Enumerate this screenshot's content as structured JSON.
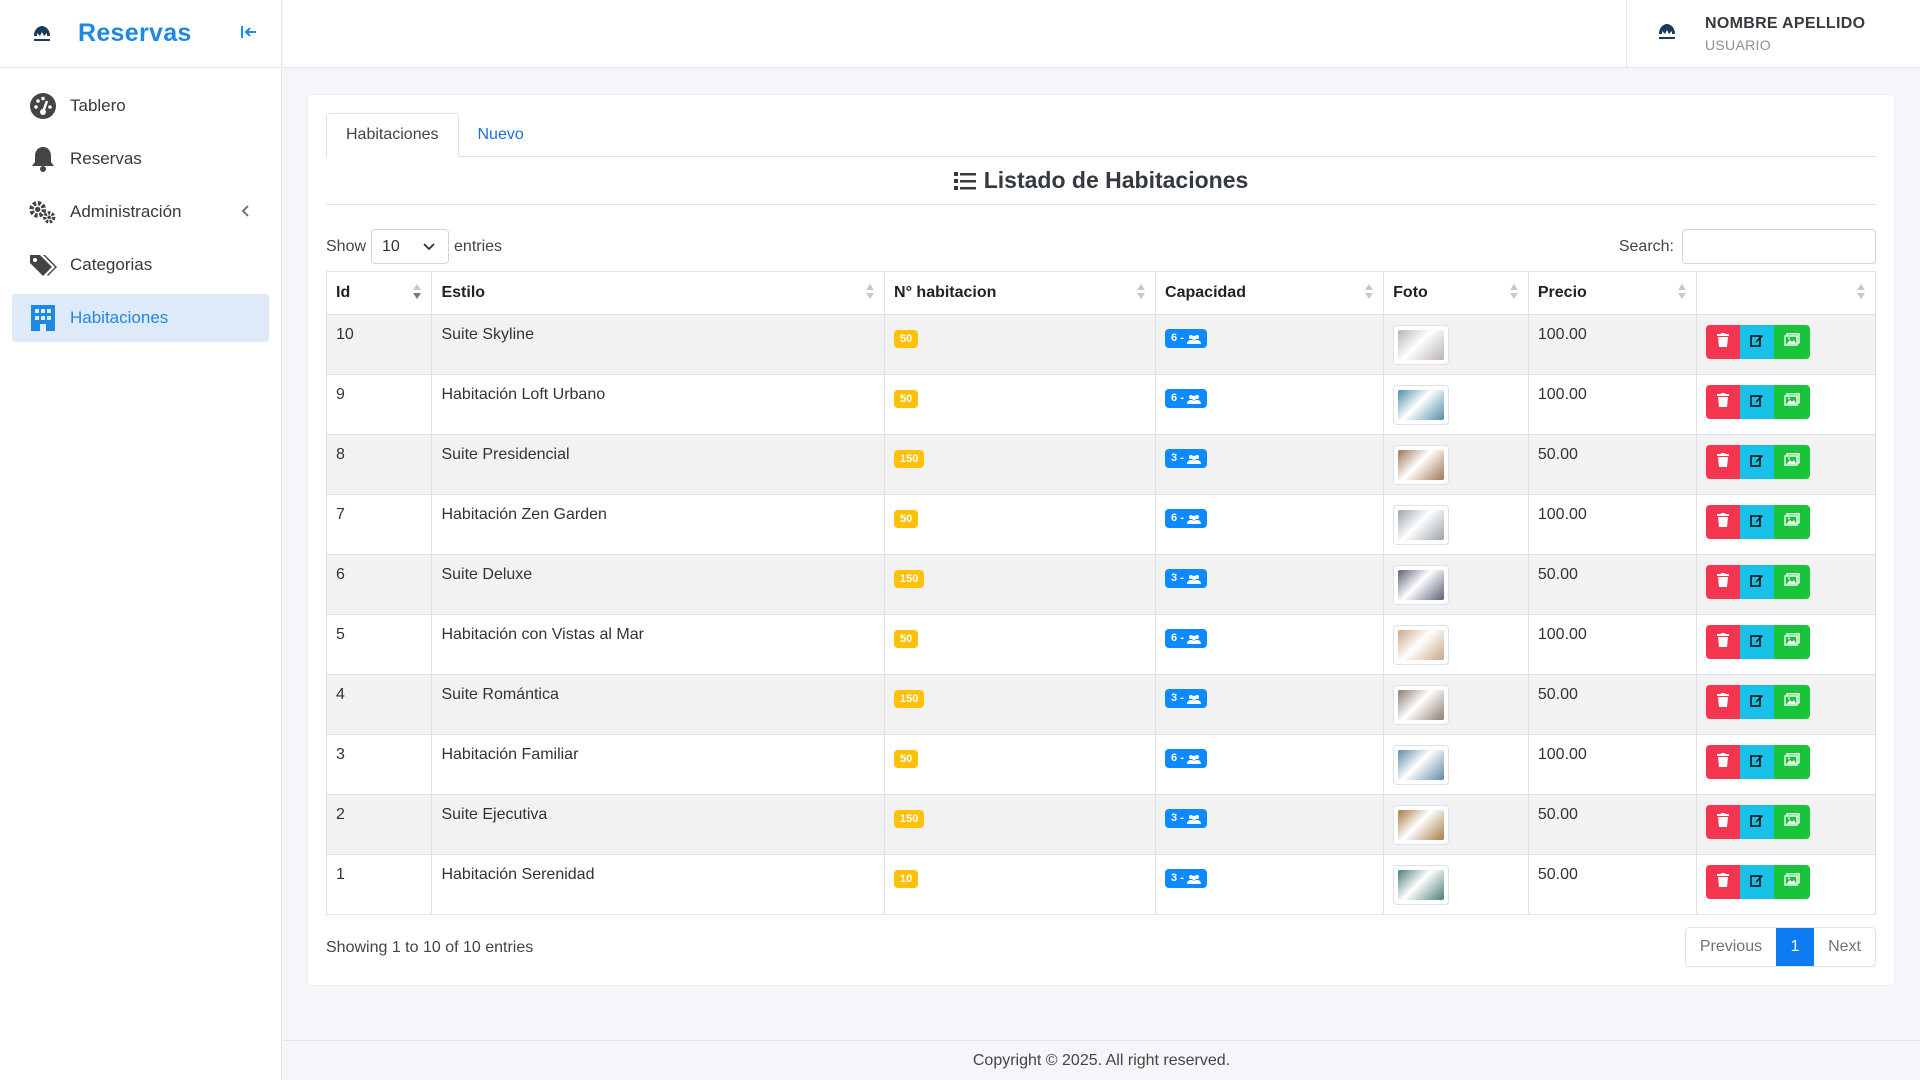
{
  "brand": {
    "title": "Reservas",
    "logo_icon": "hotel-logo-icon"
  },
  "sidebar": {
    "items": [
      {
        "label": "Tablero",
        "icon": "dashboard-icon"
      },
      {
        "label": "Reservas",
        "icon": "bell-icon"
      },
      {
        "label": "Administración",
        "icon": "cogs-icon"
      },
      {
        "label": "Categorias",
        "icon": "tags-icon"
      },
      {
        "label": "Habitaciones",
        "icon": "building-icon",
        "active": true
      }
    ]
  },
  "user": {
    "name": "NOMBRE APELLIDO",
    "role": "USUARIO"
  },
  "tabs": [
    {
      "label": "Habitaciones"
    },
    {
      "label": "Nuevo"
    }
  ],
  "card_title": "Listado de Habitaciones",
  "table_controls": {
    "show_label": "Show",
    "page_size": "10",
    "entries_label": "entries",
    "search_label": "Search:",
    "search_value": ""
  },
  "columns": [
    "Id",
    "Estilo",
    "N° habitacion",
    "Capacidad",
    "Foto",
    "Precio",
    ""
  ],
  "rows": [
    {
      "id": "10",
      "estilo": "Suite Skyline",
      "habitacion": "50",
      "capacidad": "6 -",
      "precio": "100.00",
      "foto_color": "#b9b1b4"
    },
    {
      "id": "9",
      "estilo": "Habitación Loft Urbano",
      "habitacion": "50",
      "capacidad": "6 -",
      "precio": "100.00",
      "foto_color": "#4f8ea8"
    },
    {
      "id": "8",
      "estilo": "Suite Presidencial",
      "habitacion": "150",
      "capacidad": "3 -",
      "precio": "50.00",
      "foto_color": "#a07451"
    },
    {
      "id": "7",
      "estilo": "Habitación Zen Garden",
      "habitacion": "50",
      "capacidad": "6 -",
      "precio": "100.00",
      "foto_color": "#9aa3ab"
    },
    {
      "id": "6",
      "estilo": "Suite Deluxe",
      "habitacion": "150",
      "capacidad": "3 -",
      "precio": "50.00",
      "foto_color": "#5a6075"
    },
    {
      "id": "5",
      "estilo": "Habitación con Vistas al Mar",
      "habitacion": "50",
      "capacidad": "6 -",
      "precio": "100.00",
      "foto_color": "#c9a788"
    },
    {
      "id": "4",
      "estilo": "Suite Romántica",
      "habitacion": "150",
      "capacidad": "3 -",
      "precio": "50.00",
      "foto_color": "#8b7d70"
    },
    {
      "id": "3",
      "estilo": "Habitación Familiar",
      "habitacion": "50",
      "capacidad": "6 -",
      "precio": "100.00",
      "foto_color": "#5e8aa6"
    },
    {
      "id": "2",
      "estilo": "Suite Ejecutiva",
      "habitacion": "150",
      "capacidad": "3 -",
      "precio": "50.00",
      "foto_color": "#a67b45"
    },
    {
      "id": "1",
      "estilo": "Habitación Serenidad",
      "habitacion": "10",
      "capacidad": "3 -",
      "precio": "50.00",
      "foto_color": "#4e7d7a"
    }
  ],
  "info": "Showing 1 to 10 of 10 entries",
  "pagination": {
    "previous": "Previous",
    "current": "1",
    "next": "Next"
  },
  "footer": "Copyright © 2025. All right reserved.",
  "colors": {
    "primary": "#1e88e5",
    "badge_yellow": "#ffc107",
    "badge_blue": "#0d8aff",
    "delete": "#f33550",
    "edit": "#17c1e8",
    "image": "#19c33a"
  }
}
